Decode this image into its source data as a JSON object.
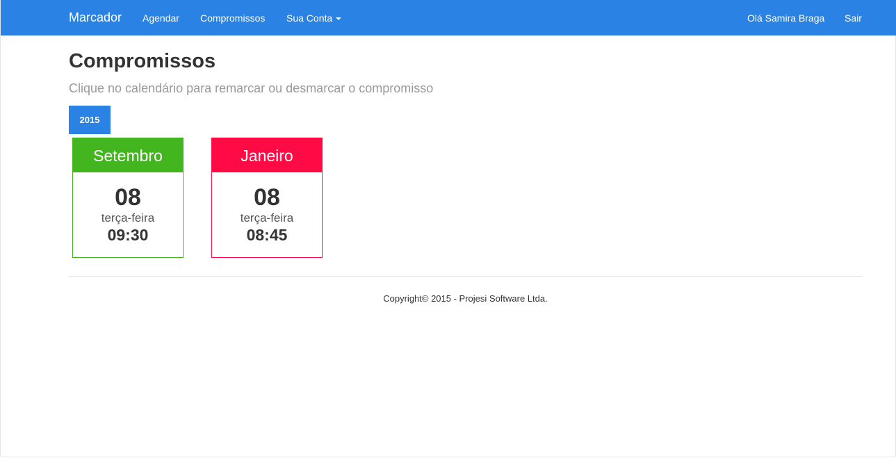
{
  "navbar": {
    "brand": "Marcador",
    "links": [
      "Agendar",
      "Compromissos",
      "Sua Conta"
    ],
    "greeting": "Olá Samira Braga",
    "logout": "Sair"
  },
  "page": {
    "title": "Compromissos",
    "subtitle": "Clique no calendário para remarcar ou desmarcar o compromisso"
  },
  "year_tab": "2015",
  "appointments": [
    {
      "month": "Setembro",
      "day": "08",
      "weekday": "terça-feira",
      "time": "09:30",
      "color": "#43b51f"
    },
    {
      "month": "Janeiro",
      "day": "08",
      "weekday": "terça-feira",
      "time": "08:45",
      "color": "#ff0a45"
    }
  ],
  "footer": "Copyright© 2015 - Projesi Software Ltda."
}
